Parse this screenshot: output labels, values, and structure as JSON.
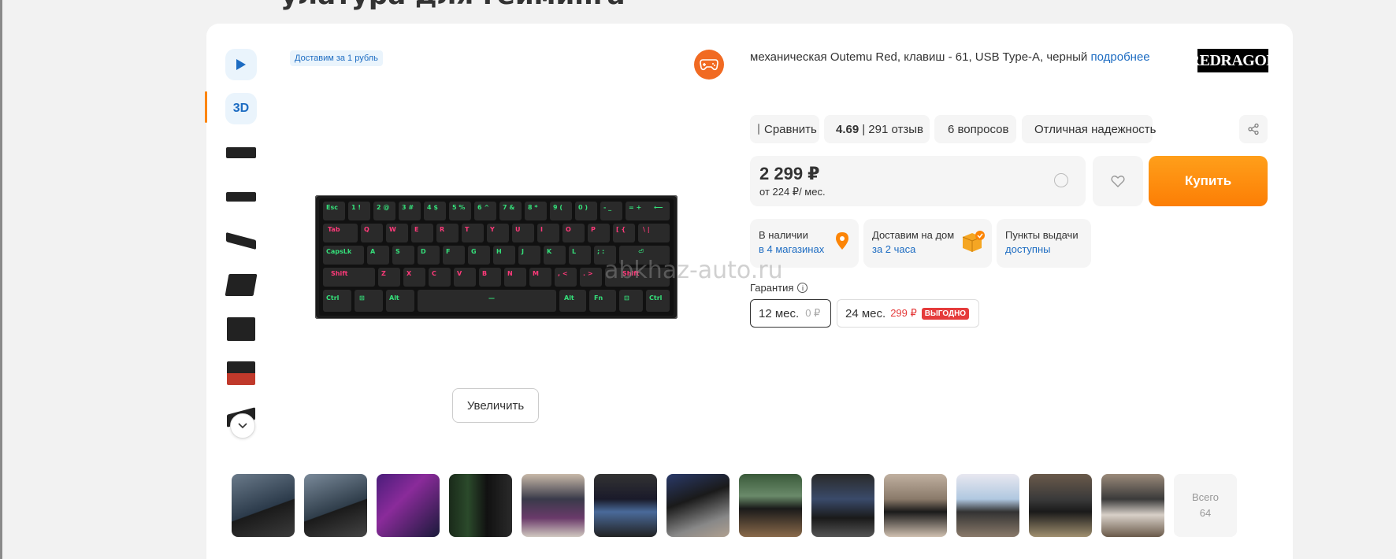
{
  "page": {
    "title_clipped": "улатура для гейминга"
  },
  "thumbs": {
    "label_3d": "3D"
  },
  "badge": {
    "delivery": "Доставим за 1 рубль"
  },
  "image": {
    "zoom_label": "Увеличить"
  },
  "product": {
    "title": "механическая Outemu Red, клавиш - 61, USB Type-A, черный",
    "more_link": "подробнее",
    "brand": "REDRAGON"
  },
  "meta": {
    "compare": "Сравнить",
    "rating": "4.69",
    "reviews": "| 291 отзыв",
    "questions": "6 вопросов",
    "reliability": "Отличная надежность"
  },
  "price": {
    "main": "2 299 ₽",
    "monthly": "от 224 ₽/ мес."
  },
  "buy": {
    "label": "Купить"
  },
  "availability": {
    "stock_title": "В наличии",
    "stock_link": "в 4 магазинах",
    "home_title": "Доставим на дом",
    "home_link": "за 2 часа",
    "pickup_title": "Пункты выдачи",
    "pickup_link": "доступны"
  },
  "warranty": {
    "label": "Гарантия",
    "opt1_term": "12 мес.",
    "opt1_price": "0 ₽",
    "opt2_term": "24 мес.",
    "opt2_price": "299 ₽",
    "opt2_tag": "ВЫГОДНО"
  },
  "watermark": "abkhaz-auto.ru",
  "gallery": {
    "total_line1": "Всего",
    "total_line2": "64"
  },
  "colors": {
    "accent": "#fc8507",
    "link": "#1d6cc2",
    "sale": "#e53b3b"
  }
}
